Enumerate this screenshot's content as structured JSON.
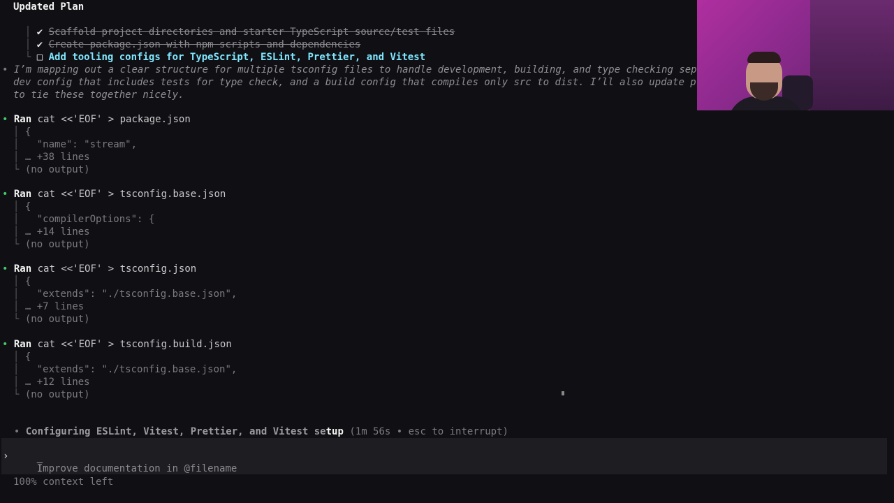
{
  "plan": {
    "title": "Updated Plan",
    "items": [
      {
        "mark": "✔",
        "text": "Scaffold project directories and starter TypeScript source/test files"
      },
      {
        "mark": "✔",
        "text": "Create package.json with npm scripts and dependencies"
      },
      {
        "mark": "□",
        "text": "Add tooling configs for TypeScript, ESLint, Prettier, and Vitest"
      }
    ]
  },
  "thought": {
    "lines": [
      "I’m mapping out a clear structure for multiple tsconfig files to handle development, building, and type checking sep",
      "dev config that includes tests for type check, and a build config that compiles only src to dist. I’ll also update p",
      "to tie these together nicely."
    ]
  },
  "runs": [
    {
      "label": "Ran",
      "cmd": "cat <<'EOF' > package.json",
      "l1": "{",
      "l2": "\"name\": \"stream\",",
      "more": "+38 lines",
      "out": "(no output)"
    },
    {
      "label": "Ran",
      "cmd": "cat <<'EOF' > tsconfig.base.json",
      "l1": "{",
      "l2": "\"compilerOptions\": {",
      "more": "+14 lines",
      "out": "(no output)"
    },
    {
      "label": "Ran",
      "cmd": "cat <<'EOF' > tsconfig.json",
      "l1": "{",
      "l2": "\"extends\": \"./tsconfig.base.json\",",
      "more": "+7 lines",
      "out": "(no output)"
    },
    {
      "label": "Ran",
      "cmd": "cat <<'EOF' > tsconfig.build.json",
      "l1": "{",
      "l2": "\"extends\": \"./tsconfig.base.json\",",
      "more": "+12 lines",
      "out": "(no output)"
    }
  ],
  "status": {
    "text_a": "Configuring ESLint, Vitest, Prettier, and Vitest se",
    "text_b": "tup",
    "detail": "(1m 56s • esc to interrupt)"
  },
  "input": {
    "prompt": "›",
    "placeholder_first": "I",
    "placeholder_rest": "mprove documentation in @filename"
  },
  "footer": {
    "context": "100% context left"
  },
  "glyphs": {
    "bullet": "•",
    "tree_mid": "│",
    "tree_end": "└",
    "ellipsis": "…"
  },
  "colors": {
    "bullet_green": "#3ecf6a",
    "active_task": "#7fe7ff"
  }
}
